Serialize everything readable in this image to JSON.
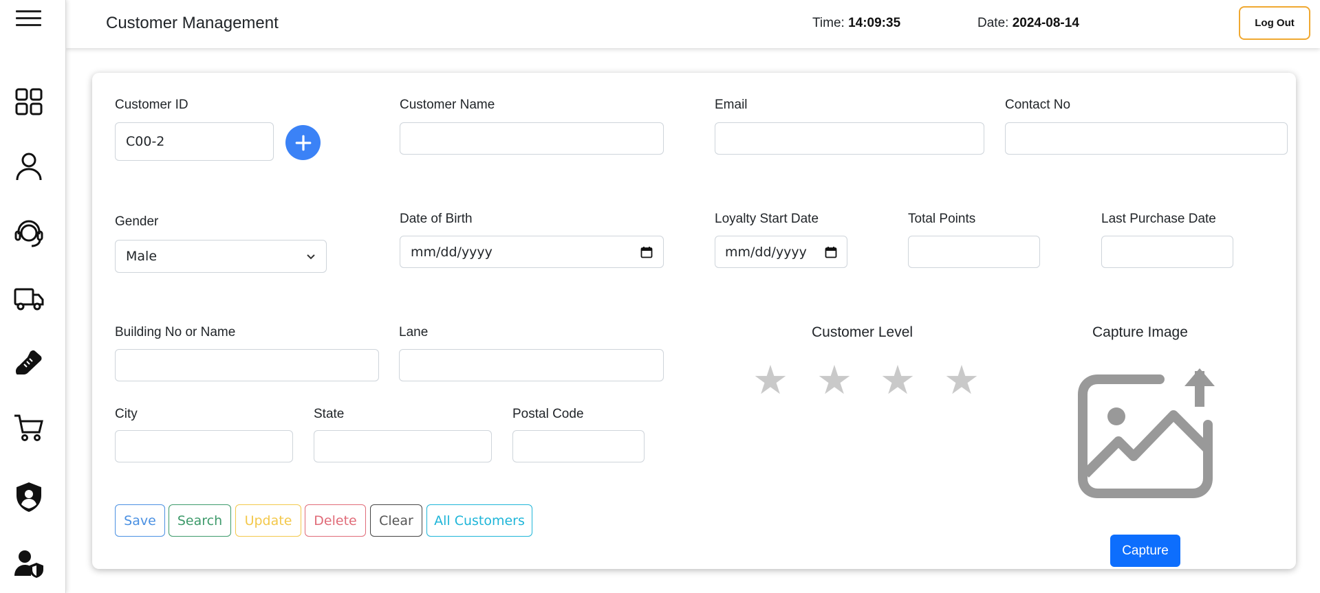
{
  "header": {
    "title": "Customer Management",
    "time_label": "Time: ",
    "time_value": "14:09:35",
    "date_label": "Date: ",
    "date_value": "2024-08-14",
    "logout_label": "Log Out"
  },
  "sidebar": {
    "items": [
      {
        "icon": "dashboard-icon"
      },
      {
        "icon": "user-icon"
      },
      {
        "icon": "headset-icon"
      },
      {
        "icon": "delivery-truck-icon"
      },
      {
        "icon": "shoe-icon"
      },
      {
        "icon": "cart-icon"
      },
      {
        "icon": "shield-user-icon"
      },
      {
        "icon": "user-shield-icon"
      }
    ]
  },
  "form": {
    "customer_id_label": "Customer ID",
    "customer_id_value": "C00-2",
    "customer_name_label": "Customer Name",
    "email_label": "Email",
    "contact_label": "Contact No",
    "gender_label": "Gender",
    "gender_value": "Male",
    "dob_label": "Date of Birth",
    "dob_placeholder": "mm/dd/yyyy",
    "loyalty_label": "Loyalty Start Date",
    "loyalty_placeholder": "mm/dd/yyyy",
    "points_label": "Total Points",
    "last_purchase_label": "Last Purchase Date",
    "building_label": "Building No or Name",
    "lane_label": "Lane",
    "city_label": "City",
    "state_label": "State",
    "postal_label": "Postal Code",
    "customer_level_label": "Customer Level",
    "customer_level_stars": 0,
    "customer_level_max": 4,
    "capture_image_label": "Capture Image",
    "capture_button": "Capture"
  },
  "actions": {
    "save": "Save",
    "search": "Search",
    "update": "Update",
    "delete": "Delete",
    "clear": "Clear",
    "all_customers": "All Customers"
  },
  "colors": {
    "save": "#4a90e2",
    "search": "#3d9a6a",
    "update": "#f3c84b",
    "delete": "#e06b78",
    "clear": "#444444",
    "all_customers": "#1eb5d8",
    "primary": "#0d6efd",
    "logout_border": "#f0a830"
  }
}
